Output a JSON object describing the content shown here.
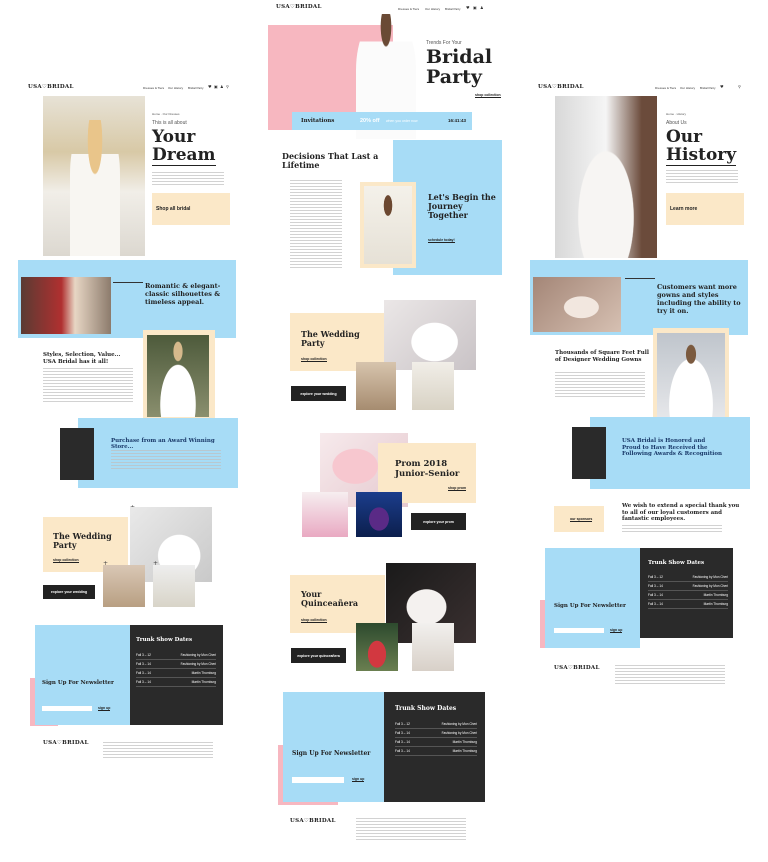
{
  "brand": {
    "logo": "USA♡BRIDAL"
  },
  "nav": {
    "item1": "Dresses & Tiers",
    "item2": "Our History",
    "item3": "Bridal Party"
  },
  "icons": [
    "heart-icon",
    "cart-icon",
    "user-icon",
    "search-icon"
  ],
  "colors": {
    "blue": "#a7dcf6",
    "cream": "#fbe8c8",
    "pink": "#f7b7c0",
    "dark": "#2a2a2a"
  },
  "left": {
    "hero_eyebrow": "This is all about",
    "hero_title1": "Your",
    "hero_title2": "Dream",
    "breadcrumb": "Home · Our Dresses",
    "shop_button": "Shop all bridal",
    "romantic_heading": "Romantic & elegant-classic silhouettes & timeless appeal.",
    "styles_heading": "Styles, Selection, Value... USA Bridal has it all!",
    "purchase_heading": "Purchase from an Award Winning Store...",
    "wedding_party": "The Wedding Party",
    "shop_collection": "shop collection",
    "explore_button": "explore your wedding",
    "trunk_title": "Trunk Show Dates",
    "newsletter": "Sign Up For Newsletter",
    "signup": "sign up"
  },
  "middle": {
    "eyebrow": "Trends For Your",
    "hero_title1": "Bridal",
    "hero_title2": "Party",
    "shop_collection": "shop collection",
    "invitations": "Invitations",
    "discount": "20% off",
    "discount_sub": "when you order now",
    "countdown": "16:41:43",
    "decisions": "Decisions That Last a Lifetime",
    "begin_journey": "Let's Begin the Journey Together",
    "schedule": "schedule today!",
    "wedding_party": "The Wedding Party",
    "shop_collection2": "shop collection",
    "explore_button": "explore your wedding",
    "prom": "Prom 2018 Junior-Senior",
    "shop_prom": "shop prom",
    "explore_prom": "explore your prom",
    "quince": "Your Quinceañera",
    "shop_quince": "shop collection",
    "explore_quince": "explore your quinceañera",
    "trunk_title": "Trunk Show Dates",
    "newsletter": "Sign Up For Newsletter",
    "signup": "sign up"
  },
  "right": {
    "eyebrow": "About Us",
    "hero_title1": "Our",
    "hero_title2": "History",
    "learn_more": "Learn more",
    "customers": "Customers want more gowns and styles including the ability to try it on.",
    "thousands": "Thousands of Square Feet Full of Designer Wedding Gowns",
    "honored": "USA Bridal is Honored and Proud to Have Received the Following Awards & Recognition",
    "thanks": "We wish to extend a special thank you to all of our loyal customers and fantastic employees.",
    "our_sponsors": "our sponsors",
    "trunk_title": "Trunk Show Dates",
    "newsletter": "Sign Up For Newsletter",
    "signup": "sign up"
  },
  "trunk_rows": [
    {
      "date": "Fall 3 – 12",
      "place": "Fashioning by Mon Cheri",
      "city": "Brownsville, TX"
    },
    {
      "date": "Fall 3 – 14",
      "place": "Fashioning by Mon Cheri",
      "city": "Brownsville, TX"
    },
    {
      "date": "Fall 3 – 14",
      "place": "Martin Thornburg",
      "city": "Laredo, TX"
    },
    {
      "date": "Fall 3 – 14",
      "place": "Martin Thornburg",
      "city": "Laredo, TX"
    }
  ]
}
